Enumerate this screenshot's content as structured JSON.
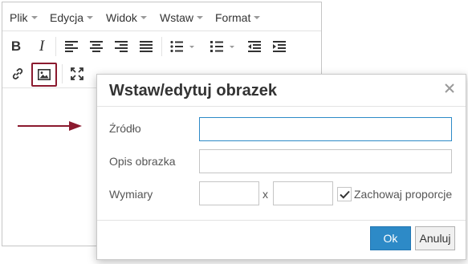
{
  "menubar": {
    "items": [
      {
        "label": "Plik"
      },
      {
        "label": "Edycja"
      },
      {
        "label": "Widok"
      },
      {
        "label": "Wstaw"
      },
      {
        "label": "Format"
      }
    ]
  },
  "toolbar": {
    "buttons": [
      {
        "icon": "bold-icon",
        "glyph": "B"
      },
      {
        "icon": "italic-icon",
        "glyph": "I"
      },
      {
        "icon": "align-left-icon"
      },
      {
        "icon": "align-center-icon"
      },
      {
        "icon": "align-right-icon"
      },
      {
        "icon": "align-justify-icon"
      },
      {
        "icon": "bullet-list-icon"
      },
      {
        "icon": "numbered-list-icon"
      },
      {
        "icon": "outdent-icon"
      },
      {
        "icon": "indent-icon"
      },
      {
        "icon": "link-icon"
      },
      {
        "icon": "image-icon",
        "active": true
      },
      {
        "icon": "fullscreen-icon"
      }
    ]
  },
  "dialog": {
    "title": "Wstaw/edytuj obrazek",
    "source_label": "Źródło",
    "source_value": "",
    "alt_label": "Opis obrazka",
    "alt_value": "",
    "dims_label": "Wymiary",
    "width_value": "",
    "height_value": "",
    "dims_separator": "x",
    "keep_ratio_label": "Zachowaj proporcje",
    "keep_ratio_checked": true,
    "ok_label": "Ok",
    "cancel_label": "Anuluj"
  },
  "colors": {
    "accent": "#2d8ac7",
    "active_outline": "#8b1a2f",
    "arrow": "#8b1a2f"
  }
}
